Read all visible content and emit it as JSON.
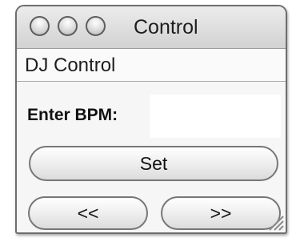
{
  "window": {
    "title": "Control"
  },
  "panel": {
    "header": "DJ Control"
  },
  "bpm": {
    "label": "Enter BPM:",
    "value": ""
  },
  "buttons": {
    "set_label": "Set",
    "prev_label": "<<",
    "next_label": ">>"
  }
}
